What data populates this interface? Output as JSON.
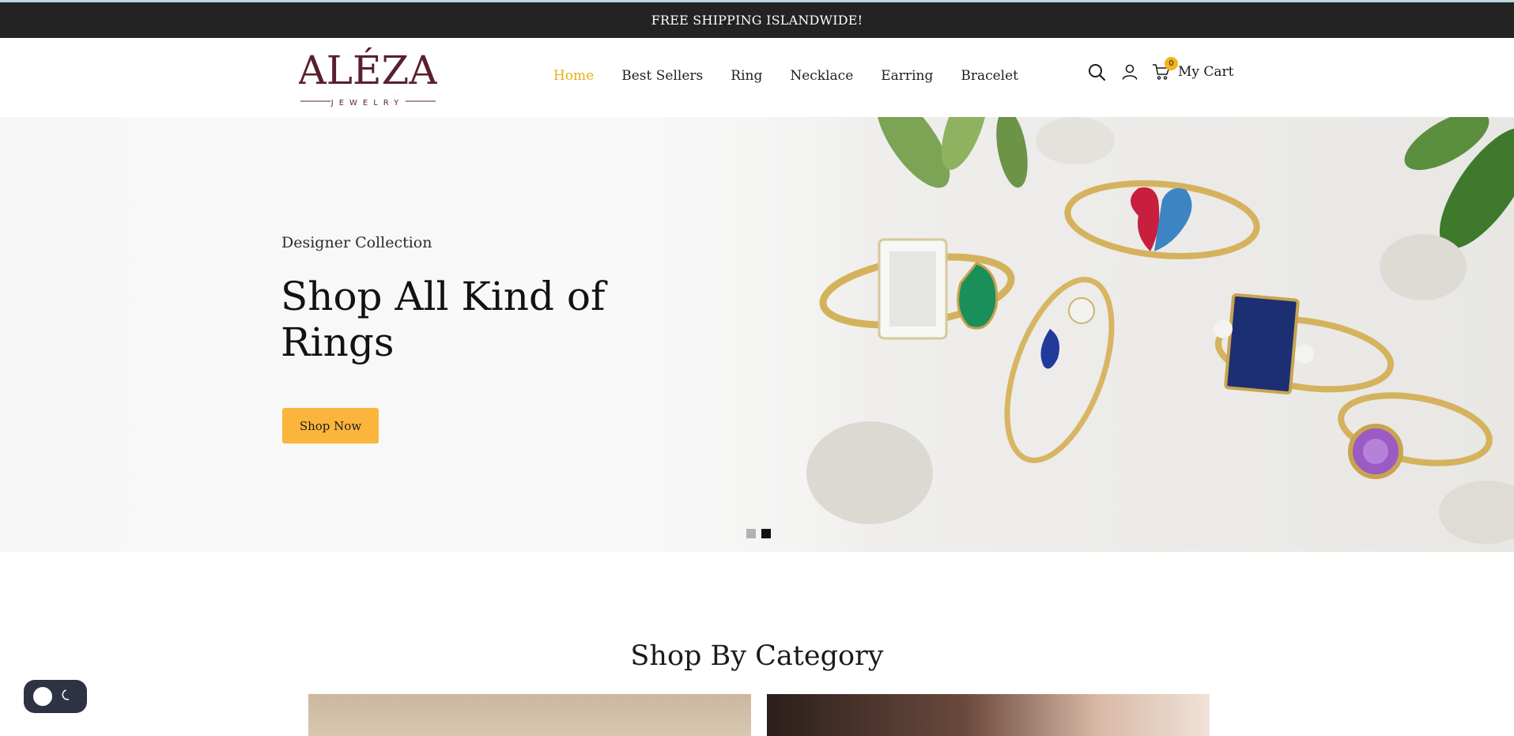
{
  "announcement": "FREE SHIPPING ISLANDWIDE!",
  "brand": {
    "name": "ALÉZA",
    "tagline": "JEWELRY",
    "color": "#5a1f2e"
  },
  "nav": {
    "items": [
      {
        "label": "Home",
        "active": true
      },
      {
        "label": "Best Sellers",
        "active": false
      },
      {
        "label": "Ring",
        "active": false
      },
      {
        "label": "Necklace",
        "active": false
      },
      {
        "label": "Earring",
        "active": false
      },
      {
        "label": "Bracelet",
        "active": false
      }
    ],
    "active_color": "#e8ad1b"
  },
  "header_tools": {
    "search_icon": "search-icon",
    "account_icon": "user-icon",
    "cart_icon": "cart-icon",
    "cart_count": "0",
    "cart_label": "My Cart"
  },
  "hero": {
    "eyebrow": "Designer Collection",
    "title": "Shop All Kind of Rings",
    "button_label": "Shop Now",
    "button_color": "#fbb53c",
    "slides": 2,
    "active_slide": 2
  },
  "category_section": {
    "title": "Shop By Category"
  },
  "theme_toggle": {
    "icon": "moon-icon",
    "bg": "#2e3344"
  }
}
